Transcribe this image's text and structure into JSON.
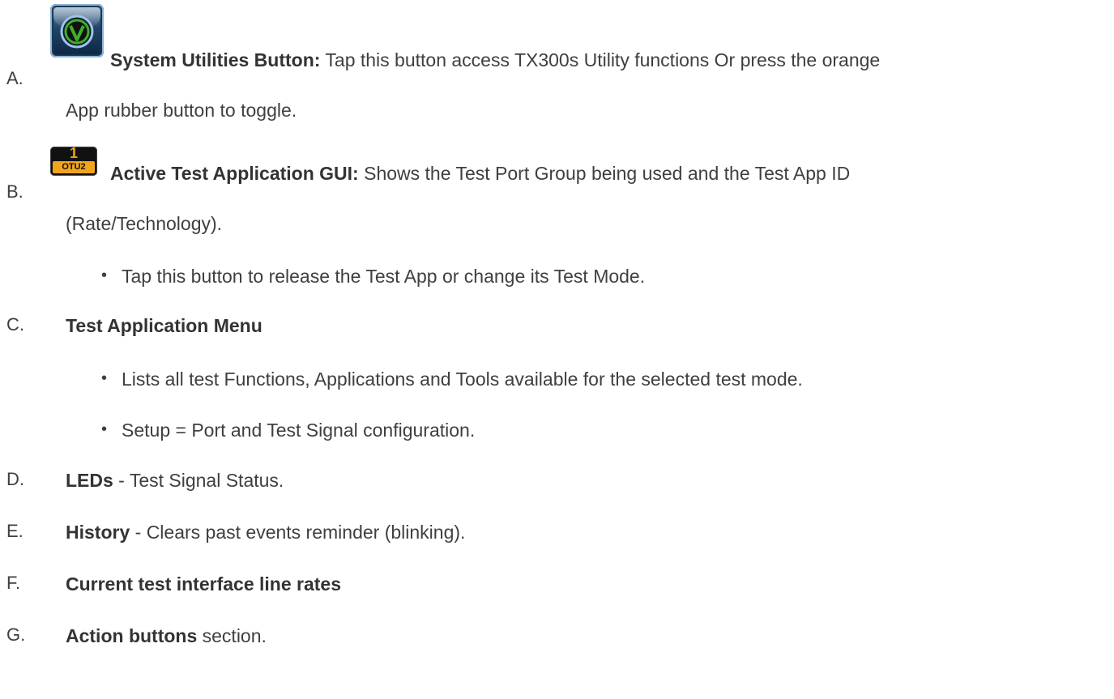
{
  "items": {
    "a": {
      "letter": "A.",
      "title": "System Utilities Button:",
      "text": " Tap this button access TX300s Utility functions Or press the orange",
      "text2": "App rubber button to toggle."
    },
    "b": {
      "letter": "B.",
      "icon_number": "1",
      "icon_rate": "OTU2",
      "title": "Active Test Application GUI:",
      "text": " Shows the Test Port Group being used and the Test App ID",
      "text2": "(Rate/Technology).",
      "bullets": [
        "Tap this button to release the Test App or change its Test Mode."
      ]
    },
    "c": {
      "letter": "C.",
      "title": "Test Application Menu",
      "bullets": [
        "Lists all test Functions, Applications and Tools available for the selected test mode.",
        "Setup = Port and Test Signal configuration."
      ]
    },
    "d": {
      "letter": "D.",
      "title": "LEDs",
      "text": " - Test Signal Status."
    },
    "e": {
      "letter": "E.",
      "title": "History",
      "text": " - Clears past events reminder (blinking)."
    },
    "f": {
      "letter": "F.",
      "title": "Current test interface line rates"
    },
    "g": {
      "letter": "G.",
      "title": "Action buttons",
      "text": " section."
    }
  },
  "icons": {
    "system_utilities": "system-utilities-icon",
    "test_app": "otu2-test-app-icon"
  },
  "colors": {
    "text": "#3f3f3f",
    "icon_orange": "#f1a51c",
    "icon_green": "#3fae2a",
    "icon_blue": "#22456a"
  }
}
